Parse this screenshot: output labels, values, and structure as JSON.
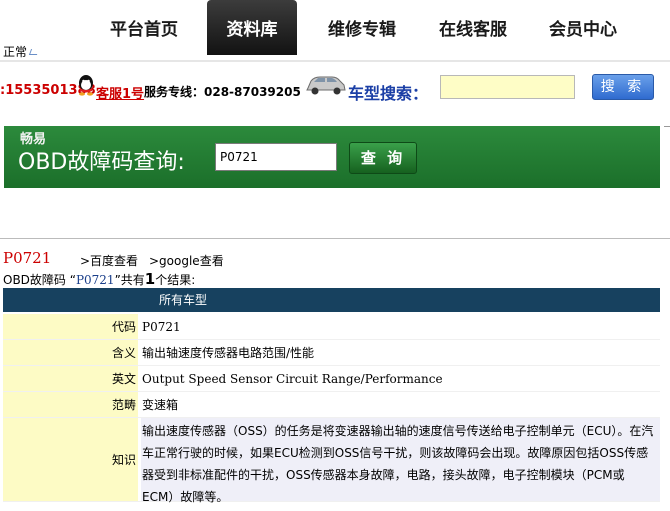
{
  "status": {
    "text": "正常"
  },
  "nav": {
    "items": [
      "平台首页",
      "资料库",
      "维修专辑",
      "在线客服",
      "会员中心"
    ],
    "active_index": 1
  },
  "service": {
    "phone": ":1553501388",
    "service_link": "客服1号",
    "hotline": "服务专线：028-87039205",
    "car_search_label": "车型搜索：",
    "search_button": "搜 索"
  },
  "banner": {
    "brand": "畅易",
    "title": "OBD故障码查询:",
    "code_value": "P0721",
    "query_button": "查 询"
  },
  "result": {
    "code": "P0721",
    "links": {
      "baidu": ">百度查看",
      "google": ">google查看"
    },
    "summary_prefix": "OBD故障码 “",
    "summary_code": "P0721",
    "summary_mid": "”共有",
    "summary_count": "1",
    "summary_suffix": "个结果:",
    "header": "所有车型",
    "rows": [
      {
        "label": "代码",
        "value": "P0721"
      },
      {
        "label": "含义",
        "value": "输出轴速度传感器电路范围/性能"
      },
      {
        "label": "英文",
        "value": "Output Speed Sensor Circuit Range/Performance"
      },
      {
        "label": "范畴",
        "value": "变速箱"
      },
      {
        "label": "知识",
        "value": "输出速度传感器（OSS）的任务是将变速器输出轴的速度信号传送给电子控制单元（ECU）。在汽车正常行驶的时候，如果ECU检测到OSS信号干扰，则该故障码会出现。故障原因包括OSS传感器受到非标准配件的干扰，OSS传感器本身故障，电路，接头故障，电子控制模块（PCM或ECM）故障等。"
      }
    ]
  }
}
